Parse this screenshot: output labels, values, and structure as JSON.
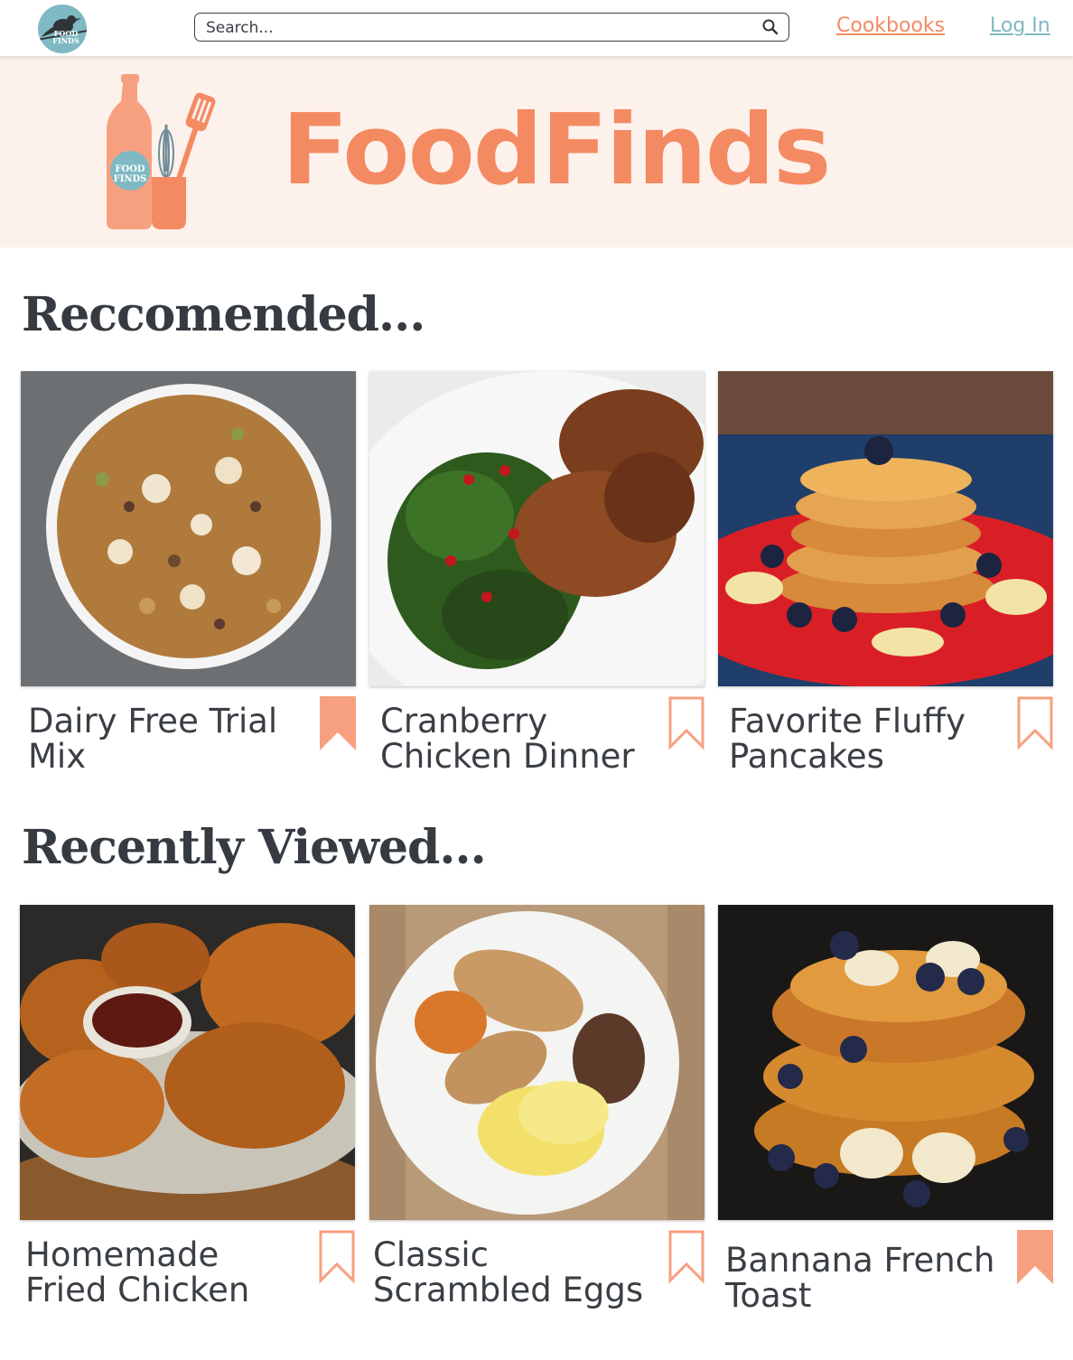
{
  "nav": {
    "logo_text_line1": "FOOD",
    "logo_text_line2": "FINDS",
    "search_placeholder": "Search...",
    "cookbooks_label": "Cookbooks",
    "login_label": "Log In"
  },
  "hero": {
    "title": "FoodFinds",
    "badge_line1": "FOOD",
    "badge_line2": "FINDS"
  },
  "recommended": {
    "title": "Reccomended...",
    "cards": [
      {
        "name": "Dairy Free Trial Mix",
        "bookmarked": true
      },
      {
        "name": "Cranberry Chicken Dinner",
        "bookmarked": false
      },
      {
        "name": "Favorite Fluffy Pancakes",
        "bookmarked": false
      }
    ]
  },
  "recent": {
    "title": "Recently Viewed...",
    "cards": [
      {
        "name": "Homemade Fried Chicken",
        "bookmarked": false
      },
      {
        "name": "Classic Scrambled Eggs",
        "bookmarked": false
      },
      {
        "name": "Bannana French Toast",
        "bookmarked": true
      }
    ]
  },
  "colors": {
    "accent": "#f48a62",
    "teal": "#7fb9c3",
    "hero_bg": "#fdf1ec",
    "text": "#3a3f45"
  }
}
